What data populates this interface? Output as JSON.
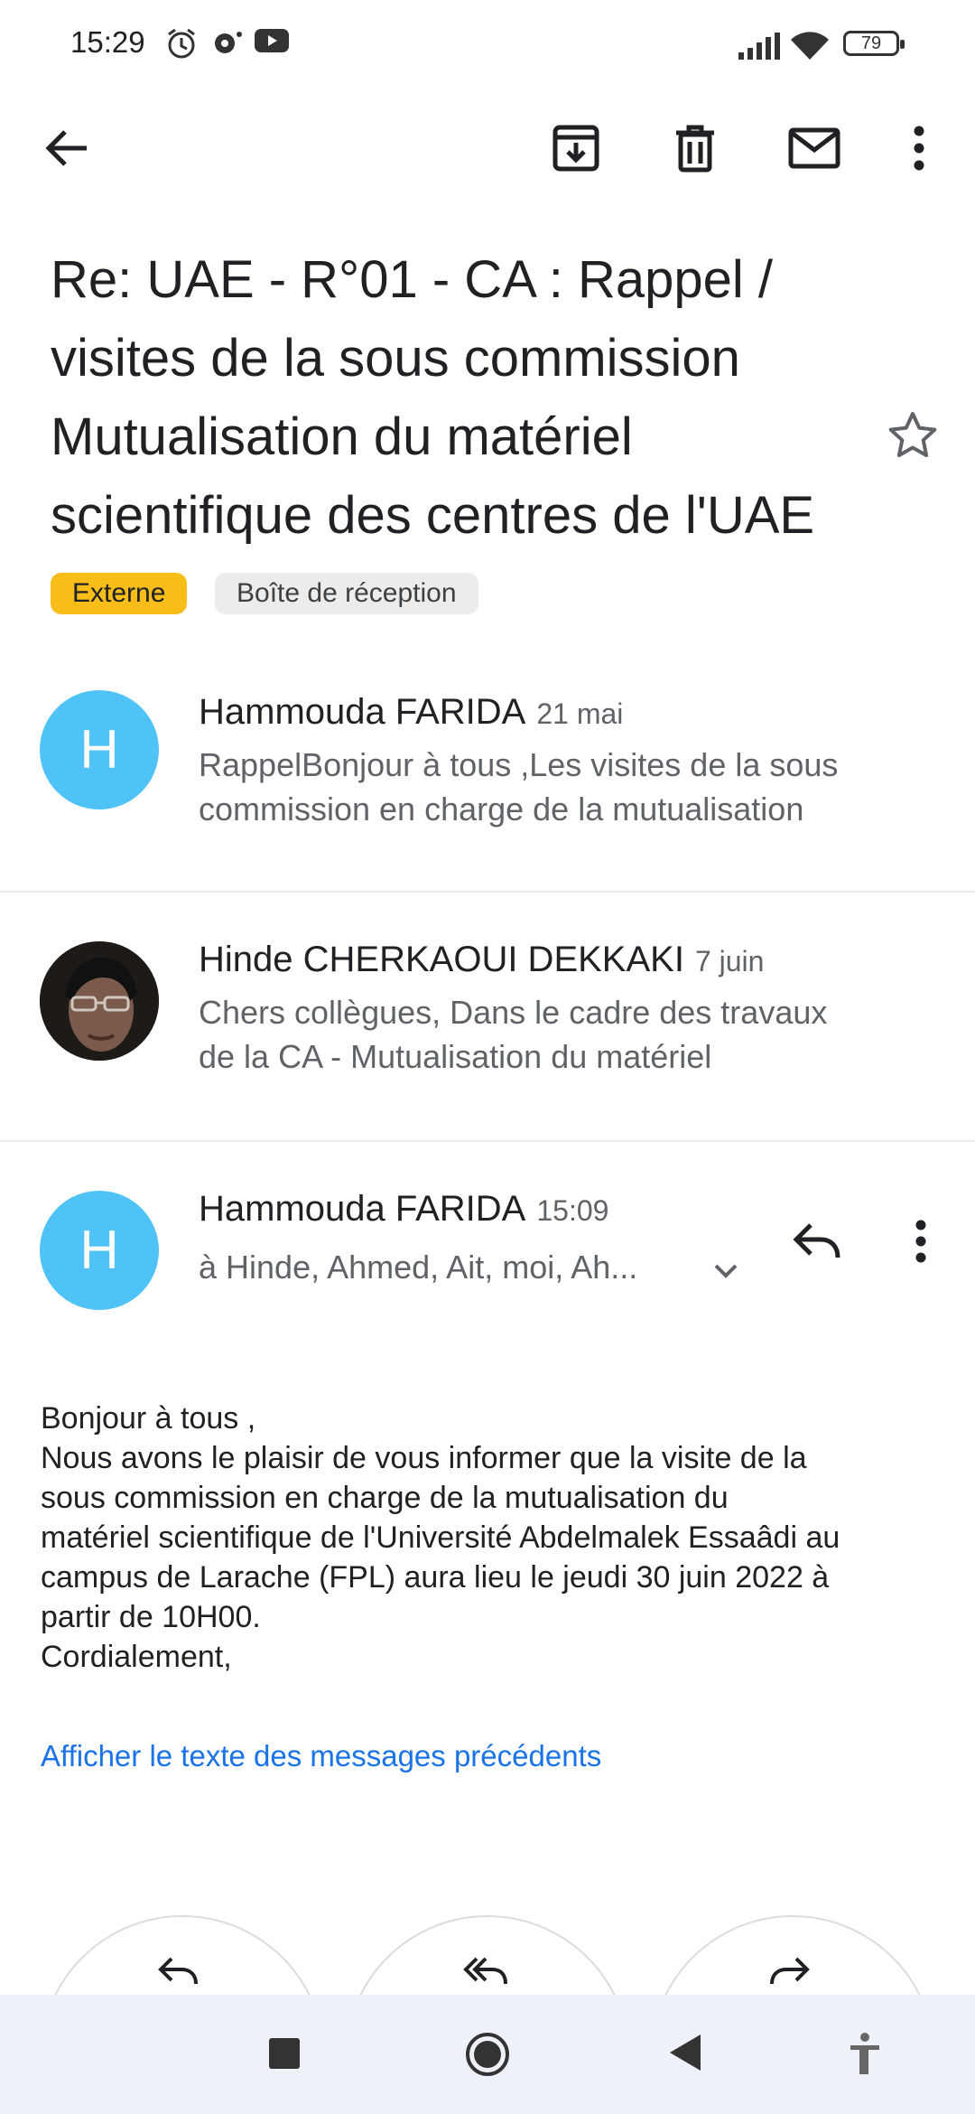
{
  "status_bar": {
    "time": "15:29",
    "battery": "79"
  },
  "toolbar": {
    "back": "back",
    "archive": "archive",
    "delete": "delete",
    "mark_unread": "mark unread",
    "more": "more options"
  },
  "thread": {
    "subject_lines": [
      "Re: UAE - R°01 - CA : Rappel /",
      "visites de la sous commission",
      "Mutualisation du matériel",
      "scientifique des centres de l'UAE"
    ],
    "labels": [
      "Externe",
      "Boîte de réception"
    ]
  },
  "messages": [
    {
      "avatar_letter": "H",
      "sender": "Hammouda FARIDA",
      "date": "21 mai",
      "snippet_lines": [
        "RappelBonjour à tous ,Les visites de la sous",
        "commission en charge de la mutualisation"
      ]
    },
    {
      "avatar_letter": "",
      "sender": "Hinde CHERKAOUI DEKKAKI",
      "date": "7 juin",
      "snippet_lines": [
        "Chers collègues, Dans le cadre des travaux",
        "de la CA - Mutualisation du matériel"
      ]
    },
    {
      "avatar_letter": "H",
      "sender": "Hammouda FARIDA",
      "date": "15:09",
      "recipients": "à Hinde, Ahmed, Ait, moi, Ah...",
      "body_lines": [
        "Bonjour à tous ,",
        "Nous avons le plaisir de vous informer  que la visite de la",
        "sous commission en charge de la mutualisation du",
        "matériel scientifique de l'Université Abdelmalek Essaâdi au",
        "campus de Larache (FPL) aura lieu le jeudi 30 juin 2022 à",
        "partir de 10H00.",
        "Cordialement,"
      ],
      "show_previous": "Afficher le texte des messages précédents"
    }
  ],
  "colors": {
    "avatar": "#4fc3f7",
    "chip_externe": "#f8bd19",
    "link": "#1a73e8"
  }
}
